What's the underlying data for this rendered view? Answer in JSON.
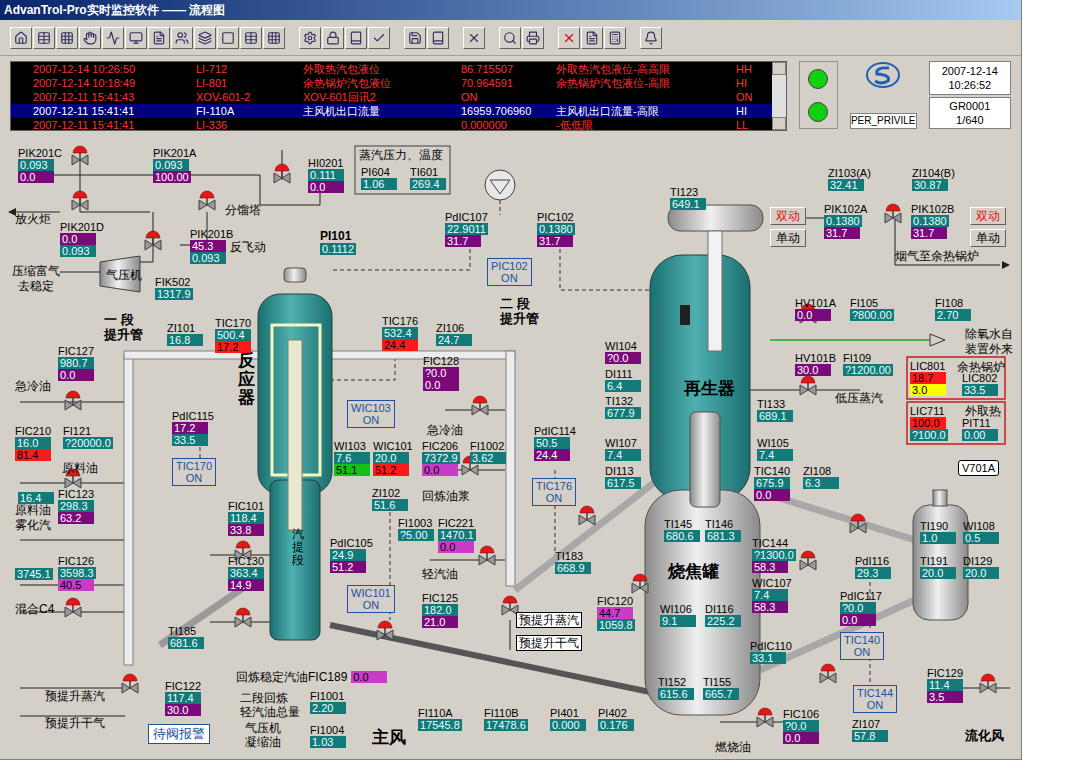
{
  "window": {
    "title": "AdvanTrol-Pro实时监控软件 —— 流程图"
  },
  "alarms": [
    {
      "time": "2007-12-14 10:26:50",
      "tag": "LI-712",
      "desc": "外取热汽包液位",
      "value": "86.715507",
      "message": "外取热汽包液位-高高限",
      "level": "HH",
      "selected": false
    },
    {
      "time": "2007-12-14 10:18:49",
      "tag": "LI-801",
      "desc": "余热锅炉汽包液位",
      "value": "70.964591",
      "message": "余热锅炉汽包液位-高限",
      "level": "HI",
      "selected": false
    },
    {
      "time": "2007-12-11 15:41:43",
      "tag": "XOV-601-2",
      "desc": "XOV-601回讯2",
      "value": "ON",
      "message": "",
      "level": "ON",
      "selected": false
    },
    {
      "time": "2007-12-11 15:41:41",
      "tag": "FI-110A",
      "desc": "主风机出口流量",
      "value": "16959.706960",
      "message": "主风机出口流量-高限",
      "level": "HI",
      "selected": true
    },
    {
      "time": "2007-12-11 15:41:41",
      "tag": "LI-336",
      "desc": "",
      "value": "0.000000",
      "message": "-低低限",
      "level": "LL",
      "selected": false
    }
  ],
  "status": {
    "indicators": [
      {
        "on": true
      },
      {
        "on": true
      }
    ],
    "date": "2007-12-14",
    "time": "10:26:52",
    "user": "PER_PRIVILE",
    "page": "GR0001",
    "page_count": "1/640"
  },
  "steam_box": {
    "title": "蒸汽压力、温度"
  },
  "pi101": {
    "name": "PI101",
    "value": "0.1112"
  },
  "fic189": {
    "label": "回炼稳定汽油FIC189",
    "value": "0.0"
  },
  "vessel_tag": "V701A",
  "tags": [
    {
      "name": "PIK201C",
      "values": [
        {
          "text": "0.093",
          "kind": "pv"
        },
        {
          "text": "0.0",
          "kind": "op"
        }
      ]
    },
    {
      "name": "PIK201A",
      "values": [
        {
          "text": "0.093",
          "kind": "pv"
        },
        {
          "text": "100.00",
          "kind": "op"
        }
      ]
    },
    {
      "name": "HI0201",
      "values": [
        {
          "text": "0.111",
          "kind": "pv"
        },
        {
          "text": "0.0",
          "kind": "op"
        }
      ]
    },
    {
      "name": "PI604",
      "values": [
        {
          "text": "1.06",
          "kind": "pv"
        }
      ]
    },
    {
      "name": "TI601",
      "values": [
        {
          "text": "269.4",
          "kind": "pv"
        }
      ]
    },
    {
      "name": "PIK201D",
      "values": [
        {
          "text": "0.0",
          "kind": "op"
        },
        {
          "text": "0.093",
          "kind": "pv"
        }
      ]
    },
    {
      "name": "PIK201B",
      "values": [
        {
          "text": "45.3",
          "kind": "op"
        },
        {
          "text": "0.093",
          "kind": "pv"
        }
      ]
    },
    {
      "name": "FIK502",
      "values": [
        {
          "text": "1317.9",
          "kind": "pv"
        }
      ]
    },
    {
      "name": "PdIC107",
      "values": [
        {
          "text": "22.9011",
          "kind": "pv"
        },
        {
          "text": "31.7",
          "kind": "op"
        }
      ]
    },
    {
      "name": "PIC102",
      "values": [
        {
          "text": "0.1380",
          "kind": "pv"
        },
        {
          "text": "31.7",
          "kind": "op"
        }
      ]
    },
    {
      "name": "TI123",
      "values": [
        {
          "text": "649.1",
          "kind": "pv"
        }
      ]
    },
    {
      "name": "ZI103(A)",
      "values": [
        {
          "text": "32.41",
          "kind": "pv"
        }
      ]
    },
    {
      "name": "ZI104(B)",
      "values": [
        {
          "text": "30.87",
          "kind": "pv"
        }
      ]
    },
    {
      "name": "PIK102A",
      "values": [
        {
          "text": "0.1380",
          "kind": "pv"
        },
        {
          "text": "31.7",
          "kind": "op"
        }
      ]
    },
    {
      "name": "PIK102B",
      "values": [
        {
          "text": "0.1380",
          "kind": "pv"
        },
        {
          "text": "31.7",
          "kind": "op"
        }
      ]
    },
    {
      "name": "ZI101",
      "values": [
        {
          "text": "16.8",
          "kind": "pv"
        }
      ]
    },
    {
      "name": "TIC170",
      "values": [
        {
          "text": "500.4",
          "kind": "pv"
        },
        {
          "text": "17.2",
          "kind": "alarm"
        }
      ]
    },
    {
      "name": "TIC176",
      "values": [
        {
          "text": "532.4",
          "kind": "pv"
        },
        {
          "text": "24.4",
          "kind": "alarm"
        }
      ]
    },
    {
      "name": "ZI106",
      "values": [
        {
          "text": "24.7",
          "kind": "pv"
        }
      ]
    },
    {
      "name": "FIC127",
      "values": [
        {
          "text": "980.7",
          "kind": "pv"
        },
        {
          "text": "0.0",
          "kind": "op"
        }
      ]
    },
    {
      "name": "HV101A",
      "values": [
        {
          "text": "0.0",
          "kind": "op"
        }
      ]
    },
    {
      "name": "FI105",
      "values": [
        {
          "text": "?800.00",
          "kind": "pv"
        }
      ]
    },
    {
      "name": "FI108",
      "values": [
        {
          "text": "2.70",
          "kind": "pv"
        }
      ]
    },
    {
      "name": "FIC128",
      "values": [
        {
          "text": "?0.0",
          "kind": "op"
        },
        {
          "text": "0.0",
          "kind": "op"
        }
      ]
    },
    {
      "name": "WI104",
      "values": [
        {
          "text": "?0.0",
          "kind": "op"
        }
      ]
    },
    {
      "name": "DI111",
      "values": [
        {
          "text": "6.4",
          "kind": "pv"
        }
      ]
    },
    {
      "name": "HV101B",
      "values": [
        {
          "text": "30.0",
          "kind": "op"
        }
      ]
    },
    {
      "name": "FI109",
      "values": [
        {
          "text": "?1200.00",
          "kind": "pv"
        }
      ]
    },
    {
      "name": "TI132",
      "values": [
        {
          "text": "677.9",
          "kind": "pv"
        }
      ]
    },
    {
      "name": "TI133",
      "values": [
        {
          "text": "689.1",
          "kind": "pv"
        }
      ]
    },
    {
      "name": "PdIC115",
      "values": [
        {
          "text": "17.2",
          "kind": "op"
        },
        {
          "text": "33.5",
          "kind": "pv"
        }
      ]
    },
    {
      "name": "FIC210",
      "values": [
        {
          "text": "16.0",
          "kind": "pv"
        },
        {
          "text": "81.4",
          "kind": "alarm"
        }
      ]
    },
    {
      "name": "FI121",
      "values": [
        {
          "text": "?20000.0",
          "kind": "pv"
        }
      ]
    },
    {
      "name": "WI103",
      "values": [
        {
          "text": "7.6",
          "kind": "pv"
        },
        {
          "text": "51.1",
          "kind": "green"
        }
      ]
    },
    {
      "name": "WIC101",
      "values": [
        {
          "text": "20.0",
          "kind": "pv"
        },
        {
          "text": "51.2",
          "kind": "alarm"
        }
      ]
    },
    {
      "name": "FIC206",
      "values": [
        {
          "text": "7372.9",
          "kind": "pv"
        },
        {
          "text": "0.0",
          "kind": "magenta"
        }
      ]
    },
    {
      "name": "FI1002",
      "values": [
        {
          "text": "3.62",
          "kind": "pv"
        }
      ]
    },
    {
      "name": "PdIC114",
      "values": [
        {
          "text": "50.5",
          "kind": "pv"
        },
        {
          "text": "24.4",
          "kind": "op"
        }
      ]
    },
    {
      "name": "WI107",
      "values": [
        {
          "text": "7.4",
          "kind": "pv"
        }
      ]
    },
    {
      "name": "WI105",
      "values": [
        {
          "text": "7.4",
          "kind": "pv"
        }
      ]
    },
    {
      "name": "DI113",
      "values": [
        {
          "text": "617.5",
          "kind": "pv"
        }
      ]
    },
    {
      "name": "TIC140",
      "values": [
        {
          "text": "675.9",
          "kind": "pv"
        },
        {
          "text": "0.0",
          "kind": "op"
        }
      ]
    },
    {
      "name": "ZI108",
      "values": [
        {
          "text": "6.3",
          "kind": "pv"
        }
      ]
    },
    {
      "name": "ZI102",
      "values": [
        {
          "text": "51.6",
          "kind": "pv"
        }
      ]
    },
    {
      "name": "FIC123",
      "values": [
        {
          "text": "298.3",
          "kind": "pv"
        },
        {
          "text": "63.2",
          "kind": "op"
        }
      ]
    },
    {
      "name": "FIC101",
      "values": [
        {
          "text": "118.4",
          "kind": "pv"
        },
        {
          "text": "33.8",
          "kind": "op"
        }
      ]
    },
    {
      "name": "FI1003",
      "values": [
        {
          "text": "?5.00",
          "kind": "pv"
        }
      ]
    },
    {
      "name": "FIC221",
      "values": [
        {
          "text": "1470.1",
          "kind": "pv"
        },
        {
          "text": "0.0",
          "kind": "magenta"
        }
      ]
    },
    {
      "name": "TI145",
      "values": [
        {
          "text": "680.6",
          "kind": "pv"
        }
      ]
    },
    {
      "name": "TI146",
      "values": [
        {
          "text": "681.3",
          "kind": "pv"
        }
      ]
    },
    {
      "name": "TI190",
      "values": [
        {
          "text": "1.0",
          "kind": "pv"
        }
      ]
    },
    {
      "name": "WI108",
      "values": [
        {
          "text": "0.5",
          "kind": "pv"
        }
      ]
    },
    {
      "name": "PdIC105",
      "values": [
        {
          "text": "24.9",
          "kind": "pv"
        },
        {
          "text": "51.2",
          "kind": "op"
        }
      ]
    },
    {
      "name": "TIC144",
      "values": [
        {
          "text": "?1300.0",
          "kind": "pv"
        },
        {
          "text": "58.3",
          "kind": "op"
        }
      ]
    },
    {
      "name": "TI183",
      "values": [
        {
          "text": "668.9",
          "kind": "pv"
        }
      ]
    },
    {
      "name": "FIC126",
      "values": [
        {
          "text": "3598.3",
          "kind": "pv"
        },
        {
          "text": "40.5",
          "kind": "magenta"
        }
      ]
    },
    {
      "name": "FIC130",
      "values": [
        {
          "text": "363.4",
          "kind": "pv"
        },
        {
          "text": "14.9",
          "kind": "op"
        }
      ]
    },
    {
      "name": "PdI116",
      "values": [
        {
          "text": "29.3",
          "kind": "pv"
        }
      ]
    },
    {
      "name": "TI191",
      "values": [
        {
          "text": "20.0",
          "kind": "pv"
        }
      ]
    },
    {
      "name": "DI129",
      "values": [
        {
          "text": "20.0",
          "kind": "pv"
        }
      ]
    },
    {
      "name": "WIC107",
      "values": [
        {
          "text": "7.4",
          "kind": "pv"
        },
        {
          "text": "58.3",
          "kind": "op"
        }
      ]
    },
    {
      "name": "FIC125",
      "values": [
        {
          "text": "182.0",
          "kind": "pv"
        },
        {
          "text": "21.0",
          "kind": "op"
        }
      ]
    },
    {
      "name": "PdIC117",
      "values": [
        {
          "text": "?0.0",
          "kind": "pv"
        },
        {
          "text": "0.0",
          "kind": "op"
        }
      ]
    },
    {
      "name": "FIC120",
      "values": [
        {
          "text": "44.7",
          "kind": "magenta"
        },
        {
          "text": "1059.8",
          "kind": "pv"
        }
      ]
    },
    {
      "name": "WI106",
      "values": [
        {
          "text": "9.1",
          "kind": "pv"
        }
      ]
    },
    {
      "name": "DI116",
      "values": [
        {
          "text": "225.2",
          "kind": "pv"
        }
      ]
    },
    {
      "name": "TI185",
      "values": [
        {
          "text": "681.6",
          "kind": "pv"
        }
      ]
    },
    {
      "name": "PdIC110",
      "values": [
        {
          "text": "33.1",
          "kind": "pv"
        }
      ]
    },
    {
      "name": "FIC129",
      "values": [
        {
          "text": "11.4",
          "kind": "pv"
        },
        {
          "text": "3.5",
          "kind": "op"
        }
      ]
    },
    {
      "name": "FIC122",
      "values": [
        {
          "text": "117.4",
          "kind": "pv"
        },
        {
          "text": "30.0",
          "kind": "op"
        }
      ]
    },
    {
      "name": "TI152",
      "values": [
        {
          "text": "615.6",
          "kind": "pv"
        }
      ]
    },
    {
      "name": "TI155",
      "values": [
        {
          "text": "665.7",
          "kind": "pv"
        }
      ]
    },
    {
      "name": "FI1001",
      "values": [
        {
          "text": "2.20",
          "kind": "pv"
        }
      ]
    },
    {
      "name": "FIC106",
      "values": [
        {
          "text": "?0.0",
          "kind": "pv"
        },
        {
          "text": "0.0",
          "kind": "op"
        }
      ]
    },
    {
      "name": "FI110A",
      "values": [
        {
          "text": "17545.8",
          "kind": "pv"
        }
      ]
    },
    {
      "name": "FI110B",
      "values": [
        {
          "text": "17478.6",
          "kind": "pv"
        }
      ]
    },
    {
      "name": "PI401",
      "values": [
        {
          "text": "0.000",
          "kind": "pv"
        }
      ]
    },
    {
      "name": "PI402",
      "values": [
        {
          "text": "0.176",
          "kind": "pv"
        }
      ]
    },
    {
      "name": "ZI107",
      "values": [
        {
          "text": "57.8",
          "kind": "pv"
        }
      ]
    },
    {
      "name": "FI1004",
      "values": [
        {
          "text": "1.03",
          "kind": "pv"
        }
      ]
    },
    {
      "name": "LIC801",
      "values": [
        {
          "text": "18.7",
          "kind": "alarm"
        },
        {
          "text": "3.0",
          "kind": "yellow"
        }
      ]
    },
    {
      "name": "LIC802",
      "values": [
        {
          "text": "33.5",
          "kind": "pv"
        }
      ]
    },
    {
      "name": "LIC711",
      "values": [
        {
          "text": "100.0",
          "kind": "alarm"
        },
        {
          "text": "?100.0",
          "kind": "pv"
        }
      ]
    },
    {
      "name": "PIT11",
      "values": [
        {
          "text": "0.00",
          "kind": "pv"
        }
      ]
    }
  ],
  "loose_values": [
    {
      "text": "16.4",
      "kind": "pv"
    },
    {
      "text": "3745.1",
      "kind": "pv"
    }
  ],
  "on_boxes": [
    {
      "name": "PIC102",
      "state": "ON"
    },
    {
      "name": "WIC103",
      "state": "ON"
    },
    {
      "name": "TIC170",
      "state": "ON"
    },
    {
      "name": "TIC176",
      "state": "ON"
    },
    {
      "name": "WIC101",
      "state": "ON"
    },
    {
      "name": "TIC140",
      "state": "ON"
    },
    {
      "name": "TIC144",
      "state": "ON"
    }
  ],
  "labels": [
    {
      "text": "分馏塔",
      "kind": "normal"
    },
    {
      "text": "放火炬",
      "kind": "normal"
    },
    {
      "text": "反飞动",
      "kind": "normal"
    },
    {
      "text": "压缩富气",
      "kind": "normal"
    },
    {
      "text": "去稳定",
      "kind": "normal"
    },
    {
      "text": "气压机",
      "kind": "normal"
    },
    {
      "text": "一  段",
      "kind": "bold"
    },
    {
      "text": "提升管",
      "kind": "bold"
    },
    {
      "text": "二  段",
      "kind": "bold"
    },
    {
      "text": "提升管",
      "kind": "bold"
    },
    {
      "text": "反应器",
      "kind": "vertical"
    },
    {
      "text": "急冷油",
      "kind": "normal"
    },
    {
      "text": "急冷油",
      "kind": "normal"
    },
    {
      "text": "原料油",
      "kind": "normal"
    },
    {
      "text": "原料油",
      "kind": "normal"
    },
    {
      "text": "雾化汽",
      "kind": "normal"
    },
    {
      "text": "回炼油浆",
      "kind": "normal"
    },
    {
      "text": "轻汽油",
      "kind": "normal"
    },
    {
      "text": "汽提段",
      "kind": "vertical-small"
    },
    {
      "text": "混合C4",
      "kind": "normal"
    },
    {
      "text": "预提升蒸汽",
      "kind": "boxed"
    },
    {
      "text": "预提升干气",
      "kind": "boxed"
    },
    {
      "text": "预提升蒸汽",
      "kind": "normal"
    },
    {
      "text": "预提升干气",
      "kind": "normal"
    },
    {
      "text": "二段回炼",
      "kind": "normal"
    },
    {
      "text": "轻汽油总量",
      "kind": "normal"
    },
    {
      "text": "气压机",
      "kind": "normal"
    },
    {
      "text": "凝缩油",
      "kind": "normal"
    },
    {
      "text": "主风",
      "kind": "large"
    },
    {
      "text": "燃烧油",
      "kind": "normal"
    },
    {
      "text": "流化风",
      "kind": "bold"
    },
    {
      "text": "再生器",
      "kind": "large"
    },
    {
      "text": "烧焦罐",
      "kind": "large"
    },
    {
      "text": "烟气至余热锅炉",
      "kind": "normal"
    },
    {
      "text": "除氧水自",
      "kind": "normal"
    },
    {
      "text": "装置外来",
      "kind": "normal"
    },
    {
      "text": "低压蒸汽",
      "kind": "normal"
    },
    {
      "text": "余热锅炉",
      "kind": "normal"
    },
    {
      "text": "外取热",
      "kind": "normal"
    }
  ],
  "buttons": [
    {
      "text": "双动",
      "active": true
    },
    {
      "text": "单动",
      "active": false
    },
    {
      "text": "双动",
      "active": true
    },
    {
      "text": "单动",
      "active": false
    }
  ],
  "alarm_button": "待阀报警"
}
